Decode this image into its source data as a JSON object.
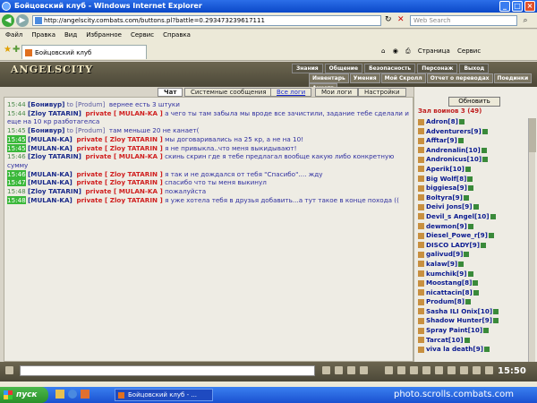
{
  "window": {
    "title": "Бойцовский клуб - Windows Internet Explorer",
    "address": "http://angelscity.combats.com/buttons.pl?battle=0.293473239617111",
    "search_placeholder": "Web Search"
  },
  "menu": [
    "Файл",
    "Правка",
    "Вид",
    "Избранное",
    "Сервис",
    "Справка"
  ],
  "tab": {
    "label": "Бойцовский клуб"
  },
  "ie_commands": {
    "page": "Страница",
    "tools": "Сервис"
  },
  "game": {
    "logo": "ANGELSCITY",
    "topnav": [
      "Знания",
      "Общение",
      "Безопасность",
      "Персонаж",
      "Выход"
    ],
    "subnav": [
      "Инвентарь",
      "Умения",
      "Мой Скролл",
      "Отчет о переводах",
      "Поединки",
      "Анкета"
    ]
  },
  "chat_tabs": [
    "Чат",
    "Системные сообщения",
    "Все логи",
    "Мои логи",
    "Настройки"
  ],
  "messages": [
    {
      "time": "15:44",
      "hl": false,
      "from": "[Бонивур]",
      "to": "to [Produm]",
      "private": "",
      "text": "вернее есть 3 штуки"
    },
    {
      "time": "15:44",
      "hl": false,
      "from": "[Zloy TATARIN]",
      "to": "",
      "private": "private [ MULAN-KA ]",
      "text": "а чего ты там забыла мы вроде все зачистили, задание тебе сделали и еще на 10 кр разботагелса"
    },
    {
      "time": "15:45",
      "hl": false,
      "from": "[Бонивур]",
      "to": "to [Produm]",
      "private": "",
      "text": "там меньше 20 не канает("
    },
    {
      "time": "15:45",
      "hl": true,
      "from": "[MULAN-KA]",
      "to": "",
      "private": "private [ Zloy TATARIN ]",
      "text": "мы договаривались на 25 кр, а не на 10!"
    },
    {
      "time": "15:45",
      "hl": true,
      "from": "[MULAN-KA]",
      "to": "",
      "private": "private [ Zloy TATARIN ]",
      "text": "я не привыкла..что меня выкидывают!"
    },
    {
      "time": "15:46",
      "hl": false,
      "from": "[Zloy TATARIN]",
      "to": "",
      "private": "private [ MULAN-KA ]",
      "text": "скинь скрин где я тебе предлагал вообще какую либо конкретную сумму"
    },
    {
      "time": "15:46",
      "hl": true,
      "from": "[MULAN-KA]",
      "to": "",
      "private": "private [ Zloy TATARIN ]",
      "text": "я так и не дождался от тебя \"Спасибо\".... жду"
    },
    {
      "time": "15:47",
      "hl": true,
      "from": "[MULAN-KA]",
      "to": "",
      "private": "private [ Zloy TATARIN ]",
      "text": "спасибо что ты меня выкинул"
    },
    {
      "time": "15:48",
      "hl": false,
      "from": "[Zloy TATARIN]",
      "to": "",
      "private": "private [ MULAN-KA ]",
      "text": "пожалуйста"
    },
    {
      "time": "15:48",
      "hl": true,
      "from": "[MULAN-KA]",
      "to": "",
      "private": "private [ Zloy TATARIN ]",
      "text": "я уже хотела тебя в друзья добавить...а тут такое в конце похода (("
    }
  ],
  "panel": {
    "refresh": "Обновить",
    "hall_title": "Зал воинов 3 (49)",
    "players": [
      "Adron[8]",
      "Adventurers[9]",
      "Afftar[9]",
      "Andrenalin[10]",
      "Andronicus[10]",
      "Aperik[10]",
      "Big Wolf[8]",
      "biggiesa[9]",
      "Boltyra[9]",
      "Deivi Jons[9]",
      "Devil_s Angel[10]",
      "dewmon[9]",
      "Diesel_Powe_r[9]",
      "DISCO LADY[9]",
      "galivud[9]",
      "kalaw[9]",
      "kumchik[9]",
      "Moostang[8]",
      "nicattacin[8]",
      "Produm[8]",
      "Sasha ILI Onix[10]",
      "Shadow Hunter[9]",
      "Spray Paint[10]",
      "Tarcat[10]",
      "viva la death[9]"
    ]
  },
  "clock": "15:50",
  "taskbar": {
    "start": "пуск",
    "task": "Бойцовский клуб - ..."
  },
  "watermark": "photo.scrolls.combats.com"
}
